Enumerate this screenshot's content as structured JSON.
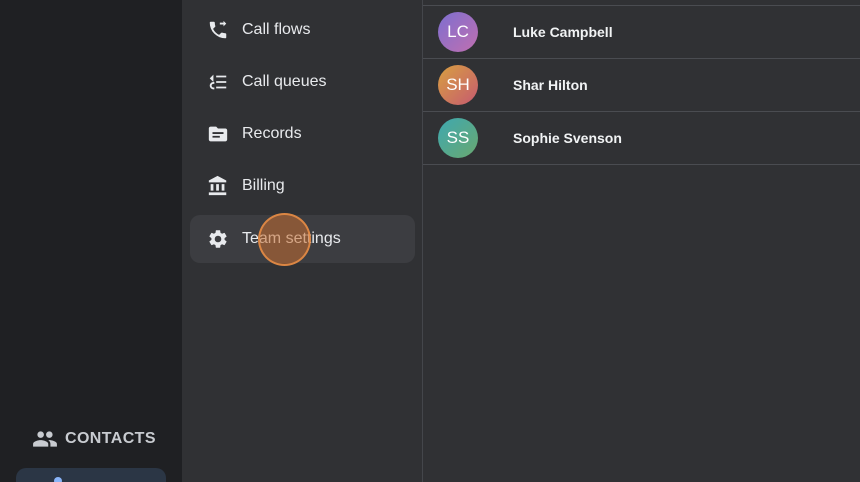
{
  "rail": {
    "contacts_label": "CONTACTS"
  },
  "menu": {
    "items": [
      {
        "label": "Call flows",
        "icon": "call-flows-icon"
      },
      {
        "label": "Call queues",
        "icon": "call-queues-icon"
      },
      {
        "label": "Records",
        "icon": "records-icon"
      },
      {
        "label": "Billing",
        "icon": "billing-icon"
      },
      {
        "label": "Team settings",
        "icon": "gear-icon",
        "active": true
      }
    ]
  },
  "contacts": [
    {
      "initials": "LC",
      "name": "Luke Campbell",
      "color": "#9b6fc0"
    },
    {
      "initials": "SH",
      "name": "Shar Hilton",
      "color": "#c8785a"
    },
    {
      "initials": "SS",
      "name": "Sophie Svenson",
      "color": "#4fa3a0"
    }
  ],
  "colors": {
    "background": "#303134",
    "rail": "#1f2023",
    "active_item": "#3c3d41",
    "click_highlight": "#e08c46"
  }
}
